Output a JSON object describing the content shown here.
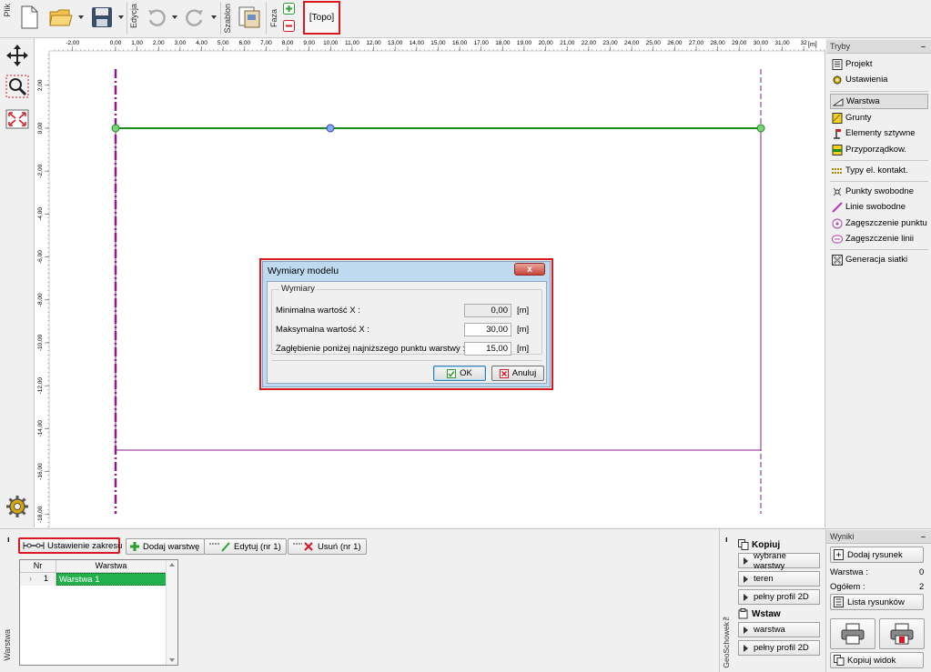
{
  "toolbar": {
    "file_label": "Plik",
    "edit_label": "Edycja",
    "template_label": "Szablon",
    "stage_label": "Faza",
    "topo_tab": "[Topo]"
  },
  "ruler": {
    "unit": "[m]",
    "x_ticks": [
      "-2,00",
      "0,00",
      "1,00",
      "2,00",
      "3,00",
      "4,00",
      "5,00",
      "6,00",
      "7,00",
      "8,00",
      "9,00",
      "10,00",
      "11,00",
      "12,00",
      "13,00",
      "14,00",
      "15,00",
      "16,00",
      "17,00",
      "18,00",
      "19,00",
      "20,00",
      "21,00",
      "22,00",
      "23,00",
      "24,00",
      "25,00",
      "26,00",
      "27,00",
      "28,00",
      "29,00",
      "30,00",
      "31,00",
      "32"
    ],
    "y_ticks": [
      "2,00",
      "0,00",
      "-2,00",
      "-4,00",
      "-6,00",
      "-8,00",
      "-10,00",
      "-12,00",
      "-14,00",
      "-16,00",
      "-18,00"
    ]
  },
  "modes_panel": {
    "title": "Tryby",
    "items": [
      {
        "label": "Projekt",
        "icon": "document-icon"
      },
      {
        "label": "Ustawienia",
        "icon": "gear-icon"
      },
      {
        "label": "Warstwa",
        "icon": "layer-icon"
      },
      {
        "label": "Grunty",
        "icon": "soil-icon"
      },
      {
        "label": "Elementy sztywne",
        "icon": "rigid-element-icon"
      },
      {
        "label": "Przyporządkow.",
        "icon": "assign-icon"
      },
      {
        "label": "Typy el. kontakt.",
        "icon": "contact-icon"
      },
      {
        "label": "Punkty swobodne",
        "icon": "free-point-icon"
      },
      {
        "label": "Linie swobodne",
        "icon": "free-line-icon"
      },
      {
        "label": "Zagęszczenie punktu",
        "icon": "point-refine-icon"
      },
      {
        "label": "Zagęszczenie linii",
        "icon": "line-refine-icon"
      },
      {
        "label": "Generacja siatki",
        "icon": "mesh-icon"
      }
    ]
  },
  "results_panel": {
    "title": "Wyniki",
    "add_drawing": "Dodaj rysunek",
    "layer_label": "Warstwa :",
    "layer_value": "0",
    "total_label": "Ogółem :",
    "total_value": "2",
    "drawings_list": "Lista rysunków",
    "copy_view": "Kopiuj widok"
  },
  "bottom": {
    "side_label": "Warstwa",
    "geoclipboard_label": "GeoSchowek™",
    "set_range": "Ustawienie zakresu",
    "add_layer": "Dodaj warstwę",
    "edit": "Edytuj (nr 1)",
    "remove": "Usuń (nr 1)",
    "table": {
      "headers": [
        "Nr",
        "Warstwa"
      ],
      "rows": [
        {
          "nr": "1",
          "name": "Warstwa 1"
        }
      ]
    },
    "copy_title": "Kopiuj",
    "copy_items": [
      "wybrane warstwy",
      "teren",
      "pełny profil 2D"
    ],
    "paste_title": "Wstaw",
    "paste_items": [
      "warstwa",
      "pełny profil 2D"
    ]
  },
  "dialog": {
    "title": "Wymiary modelu",
    "close": "x",
    "group": "Wymiary",
    "fields": [
      {
        "label": "Minimalna wartość X :",
        "value": "0,00",
        "unit": "[m]"
      },
      {
        "label": "Maksymalna wartość X :",
        "value": "30,00",
        "unit": "[m]"
      },
      {
        "label": "Zagłębienie poniżej najniższego punktu warstwy :",
        "value": "15,00",
        "unit": "[m]"
      }
    ],
    "ok": "OK",
    "cancel": "Anuluj"
  },
  "colors": {
    "accent_red": "#d9181f",
    "terrain_green": "#1a8f1a",
    "boundary_purple": "#8b1a8b",
    "row_selected": "#22b14c"
  }
}
